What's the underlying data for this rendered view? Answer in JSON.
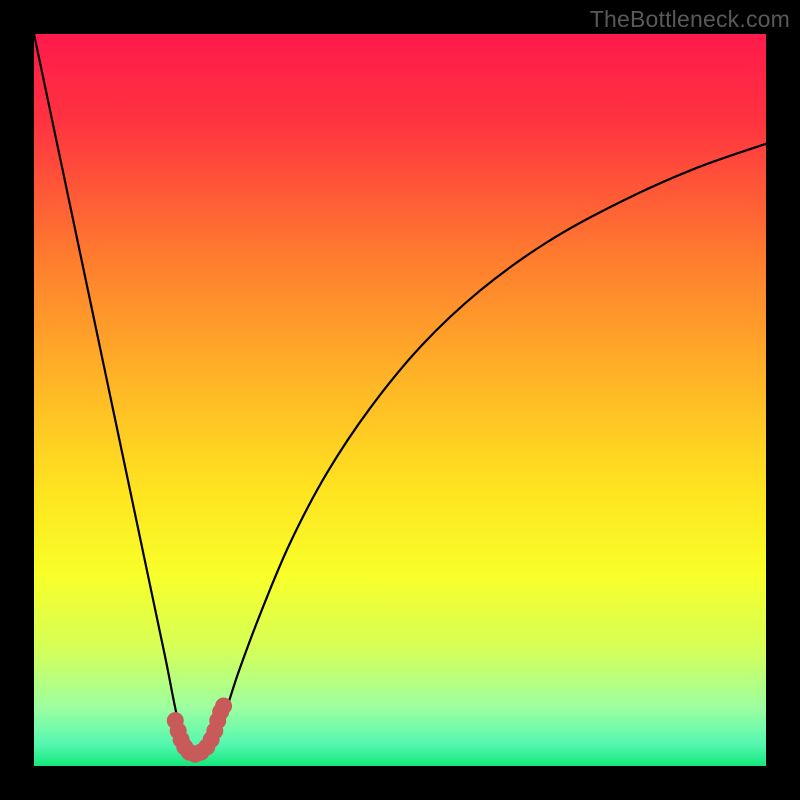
{
  "watermark": "TheBottleneck.com",
  "chart_data": {
    "type": "line",
    "title": "",
    "xlabel": "",
    "ylabel": "",
    "xlim": [
      0,
      100
    ],
    "ylim": [
      0,
      100
    ],
    "grid": false,
    "legend": false,
    "background_gradient": {
      "stops": [
        {
          "offset": 0.0,
          "color": "#ff1a4b"
        },
        {
          "offset": 0.12,
          "color": "#ff3340"
        },
        {
          "offset": 0.3,
          "color": "#ff7a2f"
        },
        {
          "offset": 0.48,
          "color": "#ffb726"
        },
        {
          "offset": 0.62,
          "color": "#ffe31f"
        },
        {
          "offset": 0.74,
          "color": "#f8ff2a"
        },
        {
          "offset": 0.84,
          "color": "#d5ff58"
        },
        {
          "offset": 0.92,
          "color": "#9dffa0"
        },
        {
          "offset": 0.97,
          "color": "#55f7b0"
        },
        {
          "offset": 1.0,
          "color": "#13e87a"
        }
      ]
    },
    "series": [
      {
        "name": "left-branch",
        "stroke": "#000000",
        "x": [
          0,
          2,
          4,
          6,
          8,
          10,
          12,
          14,
          16,
          18,
          19.5,
          20.5
        ],
        "y": [
          100,
          90.5,
          81,
          71.5,
          62,
          52.5,
          43,
          33.5,
          24,
          14.5,
          7,
          4
        ]
      },
      {
        "name": "right-branch",
        "stroke": "#000000",
        "x": [
          24.5,
          26,
          28,
          31,
          35,
          40,
          46,
          53,
          61,
          70,
          80,
          90,
          100
        ],
        "y": [
          4,
          7,
          13,
          21,
          30.5,
          40,
          49,
          57.5,
          65,
          71.5,
          77,
          81.5,
          85
        ]
      },
      {
        "name": "bottom-u-marker",
        "stroke": "#c95a5a",
        "is_marker": true,
        "x": [
          19.3,
          19.7,
          20.1,
          20.6,
          21.2,
          22.0,
          22.8,
          23.6,
          24.2,
          24.7,
          25.1,
          25.5,
          25.9
        ],
        "y": [
          6.2,
          4.8,
          3.6,
          2.6,
          1.9,
          1.6,
          1.9,
          2.6,
          3.6,
          4.8,
          6.2,
          7.4,
          8.2
        ]
      }
    ]
  }
}
